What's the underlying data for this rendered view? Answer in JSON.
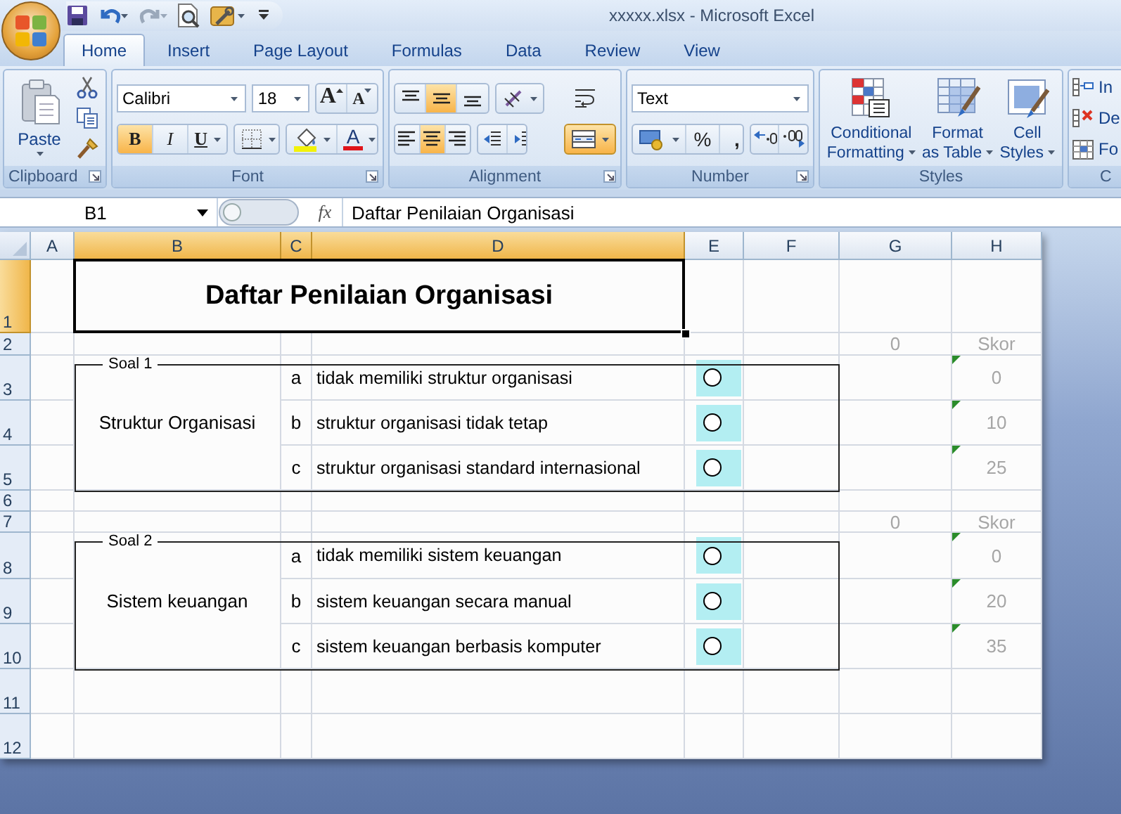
{
  "window": {
    "title": "xxxxx.xlsx - Microsoft Excel"
  },
  "tabs": [
    {
      "label": "Home",
      "selected": true
    },
    {
      "label": "Insert",
      "selected": false
    },
    {
      "label": "Page Layout",
      "selected": false
    },
    {
      "label": "Formulas",
      "selected": false
    },
    {
      "label": "Data",
      "selected": false
    },
    {
      "label": "Review",
      "selected": false
    },
    {
      "label": "View",
      "selected": false
    }
  ],
  "ribbon": {
    "clipboard": {
      "label": "Clipboard",
      "paste": "Paste"
    },
    "font": {
      "label": "Font",
      "name": "Calibri",
      "size": "18",
      "grow": "A",
      "shrink": "A",
      "font_color": "A",
      "styles": [
        {
          "kind": "bold",
          "label": "B",
          "on": true
        },
        {
          "kind": "italic",
          "label": "I",
          "on": false
        },
        {
          "kind": "underline",
          "label": "U",
          "on": false
        }
      ]
    },
    "alignment": {
      "label": "Alignment",
      "merge_on": true,
      "vertical": [
        {
          "kind": "top",
          "on": false
        },
        {
          "kind": "middle",
          "on": true
        },
        {
          "kind": "bottom",
          "on": false
        }
      ],
      "horizontal": [
        {
          "kind": "left",
          "on": false
        },
        {
          "kind": "center",
          "on": true
        },
        {
          "kind": "right",
          "on": false
        }
      ]
    },
    "number": {
      "label": "Number",
      "format": "Text",
      "percent": "%",
      "comma": ","
    },
    "styles": {
      "label": "Styles",
      "buttons": [
        {
          "kind": "conditional",
          "line1": "Conditional",
          "line2": "Formatting"
        },
        {
          "kind": "table",
          "line1": "Format",
          "line2": "as Table"
        },
        {
          "kind": "cell",
          "line1": "Cell",
          "line2": "Styles"
        }
      ]
    },
    "cells": {
      "label": "C",
      "items": [
        {
          "kind": "insert",
          "label": "In"
        },
        {
          "kind": "delete",
          "label": "De"
        },
        {
          "kind": "format",
          "label": "Fo"
        }
      ]
    }
  },
  "formula_bar": {
    "name_box": "B1",
    "function_label": "fx",
    "formula": "Daftar Penilaian Organisasi"
  },
  "sheet": {
    "columns": [
      {
        "label": "A",
        "selected": false
      },
      {
        "label": "B",
        "selected": true
      },
      {
        "label": "C",
        "selected": true
      },
      {
        "label": "D",
        "selected": true
      },
      {
        "label": "E",
        "selected": false
      },
      {
        "label": "F",
        "selected": false
      },
      {
        "label": "G",
        "selected": false
      },
      {
        "label": "H",
        "selected": false
      }
    ],
    "rows": [
      {
        "label": "1",
        "selected": true
      },
      {
        "label": "2",
        "selected": false
      },
      {
        "label": "3",
        "selected": false
      },
      {
        "label": "4",
        "selected": false
      },
      {
        "label": "5",
        "selected": false
      },
      {
        "label": "6",
        "selected": false
      },
      {
        "label": "7",
        "selected": false
      },
      {
        "label": "8",
        "selected": false
      },
      {
        "label": "9",
        "selected": false
      },
      {
        "label": "10",
        "selected": false
      },
      {
        "label": "11",
        "selected": false
      },
      {
        "label": "12",
        "selected": false
      }
    ],
    "title": "Daftar Penilaian Organisasi",
    "sections": [
      {
        "group": "Soal 1",
        "topic": "Struktur Organisasi",
        "total": "0",
        "score_header": "Skor",
        "options": [
          {
            "letter": "a",
            "text": "tidak memiliki struktur organisasi",
            "selected": false,
            "score": "0"
          },
          {
            "letter": "b",
            "text": "struktur organisasi tidak tetap",
            "selected": false,
            "score": "10"
          },
          {
            "letter": "c",
            "text": "struktur organisasi standard internasional",
            "selected": false,
            "score": "25"
          }
        ]
      },
      {
        "group": "Soal 2",
        "topic": "Sistem keuangan",
        "total": "0",
        "score_header": "Skor",
        "options": [
          {
            "letter": "a",
            "text": "tidak memiliki sistem keuangan",
            "selected": false,
            "score": "0"
          },
          {
            "letter": "b",
            "text": "sistem keuangan secara manual",
            "selected": false,
            "score": "20"
          },
          {
            "letter": "c",
            "text": "sistem keuangan berbasis komputer",
            "selected": false,
            "score": "35"
          }
        ]
      }
    ]
  }
}
